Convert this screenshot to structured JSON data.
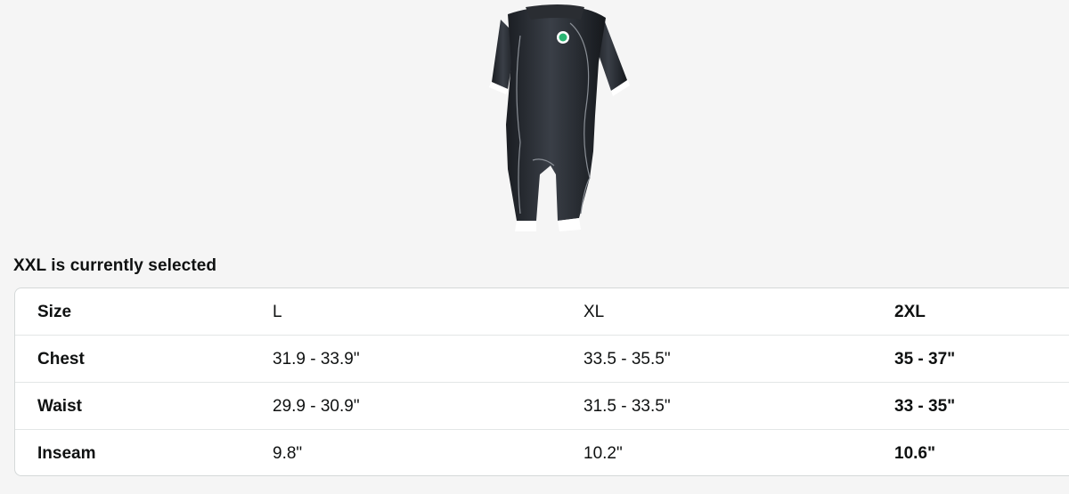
{
  "product": {
    "image_icon": "trisuit-image"
  },
  "selection": {
    "label": "XXL is currently selected"
  },
  "size_table": {
    "rows": [
      {
        "label": "Size",
        "values": [
          "L",
          "XL",
          "2XL"
        ]
      },
      {
        "label": "Chest",
        "values": [
          "31.9 - 33.9\"",
          "33.5 - 35.5\"",
          "35 - 37\""
        ]
      },
      {
        "label": "Waist",
        "values": [
          "29.9 - 30.9\"",
          "31.5 - 33.5\"",
          "33 - 35\""
        ]
      },
      {
        "label": "Inseam",
        "values": [
          "9.8\"",
          "10.2\"",
          "10.6\""
        ]
      }
    ],
    "selected_column": 2
  }
}
